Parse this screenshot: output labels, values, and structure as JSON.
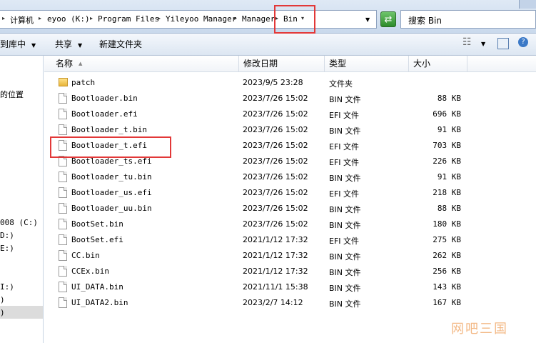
{
  "address": {
    "crumbs": [
      "计算机",
      "eyoo (K:)",
      "Program Files",
      "Yileyoo Manager",
      "Manager",
      "Bin"
    ],
    "search_placeholder": "搜索 Bin"
  },
  "toolbar": {
    "library_label": "到库中",
    "share_label": "共享",
    "new_folder_label": "新建文件夹"
  },
  "nav": {
    "items": [
      "的位置",
      "008 (C:)",
      "D:)",
      "E:)",
      "I:)",
      ")",
      ")"
    ]
  },
  "columns": {
    "name": "名称",
    "date": "修改日期",
    "type": "类型",
    "size": "大小"
  },
  "files": [
    {
      "name": "patch",
      "date": "2023/9/5 23:28",
      "type": "文件夹",
      "size": "",
      "icon": "folder-icon"
    },
    {
      "name": "Bootloader.bin",
      "date": "2023/7/26 15:02",
      "type": "BIN 文件",
      "size": "88 KB",
      "icon": "file-icon"
    },
    {
      "name": "Bootloader.efi",
      "date": "2023/7/26 15:02",
      "type": "EFI 文件",
      "size": "696 KB",
      "icon": "file-icon"
    },
    {
      "name": "Bootloader_t.bin",
      "date": "2023/7/26 15:02",
      "type": "BIN 文件",
      "size": "91 KB",
      "icon": "file-icon"
    },
    {
      "name": "Bootloader_t.efi",
      "date": "2023/7/26 15:02",
      "type": "EFI 文件",
      "size": "703 KB",
      "icon": "file-icon"
    },
    {
      "name": "Bootloader_ts.efi",
      "date": "2023/7/26 15:02",
      "type": "EFI 文件",
      "size": "226 KB",
      "icon": "file-icon"
    },
    {
      "name": "Bootloader_tu.bin",
      "date": "2023/7/26 15:02",
      "type": "BIN 文件",
      "size": "91 KB",
      "icon": "file-icon"
    },
    {
      "name": "Bootloader_us.efi",
      "date": "2023/7/26 15:02",
      "type": "EFI 文件",
      "size": "218 KB",
      "icon": "file-icon"
    },
    {
      "name": "Bootloader_uu.bin",
      "date": "2023/7/26 15:02",
      "type": "BIN 文件",
      "size": "88 KB",
      "icon": "file-icon"
    },
    {
      "name": "BootSet.bin",
      "date": "2023/7/26 15:02",
      "type": "BIN 文件",
      "size": "180 KB",
      "icon": "file-icon"
    },
    {
      "name": "BootSet.efi",
      "date": "2021/1/12 17:32",
      "type": "EFI 文件",
      "size": "275 KB",
      "icon": "file-icon"
    },
    {
      "name": "CC.bin",
      "date": "2021/1/12 17:32",
      "type": "BIN 文件",
      "size": "262 KB",
      "icon": "file-icon"
    },
    {
      "name": "CCEx.bin",
      "date": "2021/1/12 17:32",
      "type": "BIN 文件",
      "size": "256 KB",
      "icon": "file-icon"
    },
    {
      "name": "UI_DATA.bin",
      "date": "2021/11/1 15:38",
      "type": "BIN 文件",
      "size": "143 KB",
      "icon": "file-icon"
    },
    {
      "name": "UI_DATA2.bin",
      "date": "2023/2/7 14:12",
      "type": "BIN 文件",
      "size": "167 KB",
      "icon": "file-icon"
    }
  ],
  "watermark": "网吧三国",
  "colors": {
    "highlight": "#e23838",
    "watermark": "#f2b27a"
  }
}
